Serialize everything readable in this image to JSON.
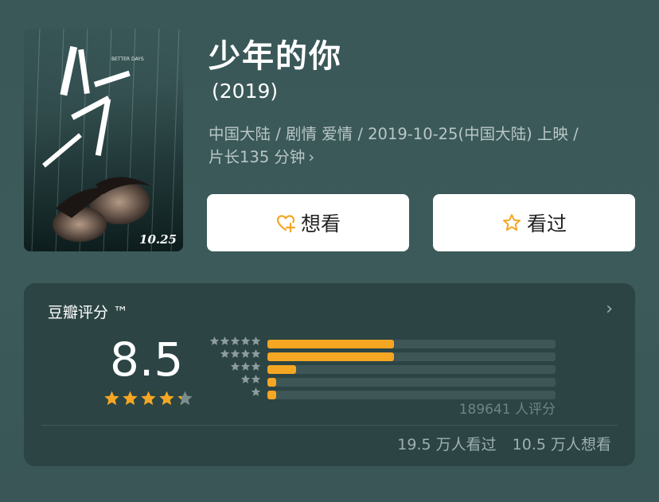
{
  "movie": {
    "title": "少年的你",
    "year": "(2019)",
    "meta_line1": "中国大陆 / 剧情 爱情 / 2019-10-25(中国大陆) 上映 /",
    "meta_line2": "片长135 分钟",
    "poster": {
      "date_text": "10.25",
      "side_text": "BETTER DAYS"
    }
  },
  "actions": {
    "want_label": "想看",
    "seen_label": "看过",
    "icons": {
      "want": "heart-plus-icon",
      "seen": "star-outline-icon"
    },
    "accent_color": "#f5a623"
  },
  "rating": {
    "title": "豆瓣评分 ™",
    "score": "8.5",
    "stars": 4.25,
    "distribution_percent": {
      "5": 44,
      "4": 44,
      "3": 10,
      "2": 3,
      "1": 3
    },
    "count_text": "189641 人评分",
    "seen_text": "19.5 万人看过",
    "want_text": "10.5 万人想看"
  }
}
